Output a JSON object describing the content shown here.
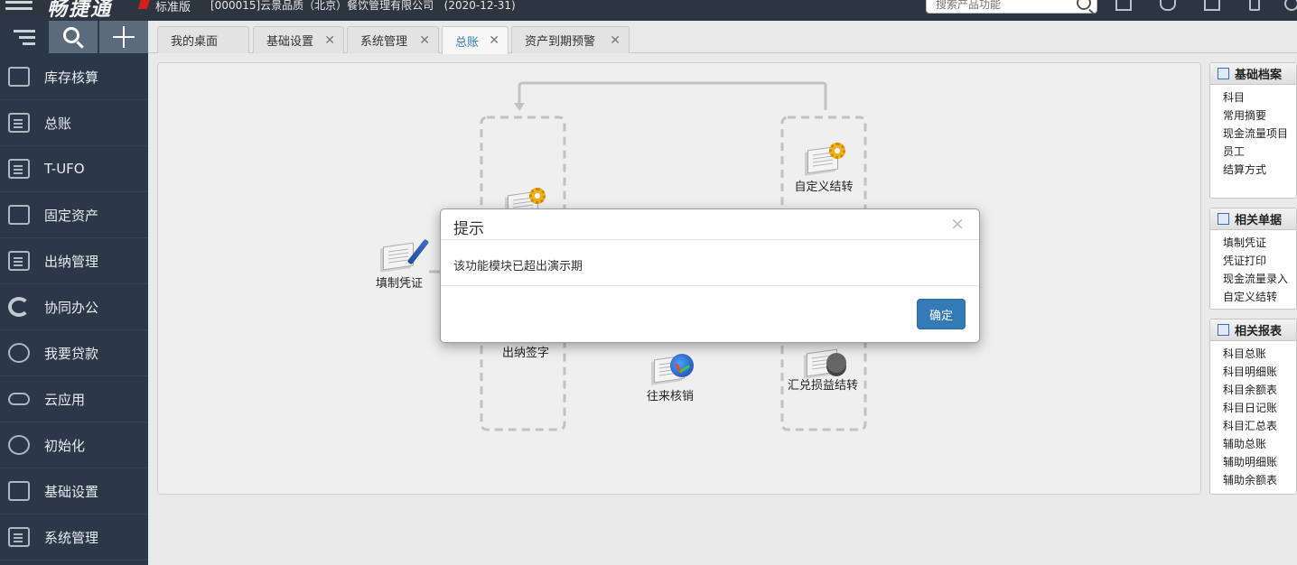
{
  "header": {
    "brand": "畅捷通",
    "edition": "标准版",
    "company": "[000015]云景品质（北京）餐饮管理有限公司",
    "date": "(2020-12-31)",
    "search_placeholder": "搜索产品功能",
    "icons": [
      "menu-icon",
      "search-icon",
      "document-icon",
      "bell-icon",
      "mail-icon",
      "phone-icon",
      "info-icon"
    ]
  },
  "sidebar": {
    "items": [
      {
        "label": "库存核算",
        "icon": "warehouse-icon"
      },
      {
        "label": "总账",
        "icon": "ledger-icon"
      },
      {
        "label": "T-UFO",
        "icon": "report-icon"
      },
      {
        "label": "固定资产",
        "icon": "asset-icon"
      },
      {
        "label": "出纳管理",
        "icon": "cashier-icon"
      },
      {
        "label": "协同办公",
        "icon": "collaboration-icon"
      },
      {
        "label": "我要贷款",
        "icon": "loan-icon"
      },
      {
        "label": "云应用",
        "icon": "cloud-icon"
      },
      {
        "label": "初始化",
        "icon": "initialize-icon"
      },
      {
        "label": "基础设置",
        "icon": "settings-icon"
      },
      {
        "label": "系统管理",
        "icon": "system-icon"
      }
    ]
  },
  "tabs": [
    {
      "label": "我的桌面",
      "closable": false
    },
    {
      "label": "基础设置",
      "closable": true
    },
    {
      "label": "系统管理",
      "closable": true
    },
    {
      "label": "总账",
      "closable": true,
      "active": true
    },
    {
      "label": "资产到期预警",
      "closable": true
    }
  ],
  "flow": {
    "nodes": {
      "fill_voucher": "填制凭证",
      "custom_transfer": "自定义结转",
      "cashier_sign": "出纳签字",
      "reconcile": "往来核销",
      "fx_transfer": "汇兑损益结转"
    }
  },
  "panels": {
    "basic": {
      "title": "基础档案",
      "items": [
        "科目",
        "常用摘要",
        "现金流量项目",
        "员工",
        "结算方式"
      ]
    },
    "docs": {
      "title": "相关单据",
      "items": [
        "填制凭证",
        "凭证打印",
        "现金流量录入",
        "自定义结转"
      ]
    },
    "reports": {
      "title": "相关报表",
      "items": [
        "科目总账",
        "科目明细账",
        "科目余额表",
        "科目日记账",
        "科目汇总表",
        "辅助总账",
        "辅助明细账",
        "辅助余额表"
      ]
    }
  },
  "modal": {
    "title": "提示",
    "close": "×",
    "message": "该功能模块已超出演示期",
    "ok_label": "确定"
  },
  "colors": {
    "topbar": "#2c3540",
    "sidebar": "#2b3847",
    "accent": "#337ab7",
    "active_tab_text": "#2f7fb8"
  }
}
